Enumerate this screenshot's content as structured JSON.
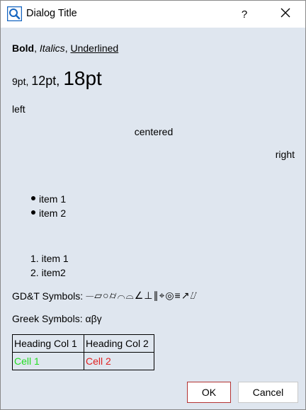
{
  "window": {
    "title": "Dialog Title",
    "help_label": "?",
    "icons": {
      "app": "search-icon",
      "close": "close-icon"
    }
  },
  "content": {
    "format_line": {
      "bold": "Bold",
      "sep1": ", ",
      "italic": "Italics",
      "sep2": ", ",
      "underlined": "Underlined"
    },
    "sizes_line": {
      "s9": "9pt",
      "sep1": ", ",
      "s12": "12pt",
      "sep2": ", ",
      "s18": "18pt"
    },
    "left": "left",
    "centered": "centered",
    "right": "right",
    "bullets": [
      "item 1",
      "item 2"
    ],
    "numbered": [
      {
        "number": "1.",
        "text": "item 1"
      },
      {
        "number": "2.",
        "text": "item2"
      }
    ],
    "gdt_label": "GD&T Symbols:",
    "gdt_symbols": "⏤⏥○⌭⌒⌓∠⊥∥⌖◎≡↗⌰",
    "greek_label": "Greek Symbols:",
    "greek_symbols": "αβγ",
    "table": {
      "headers": [
        "Heading Col 1",
        "Heading Col 2"
      ],
      "cells": [
        "Cell 1",
        "Cell 2"
      ],
      "cell_colors": [
        "#22dd22",
        "#e02020"
      ]
    }
  },
  "buttons": {
    "ok": "OK",
    "cancel": "Cancel"
  },
  "colors": {
    "dialog_background": "#dfe6ef",
    "ok_border": "#b33232",
    "app_icon": "#1565c0"
  }
}
